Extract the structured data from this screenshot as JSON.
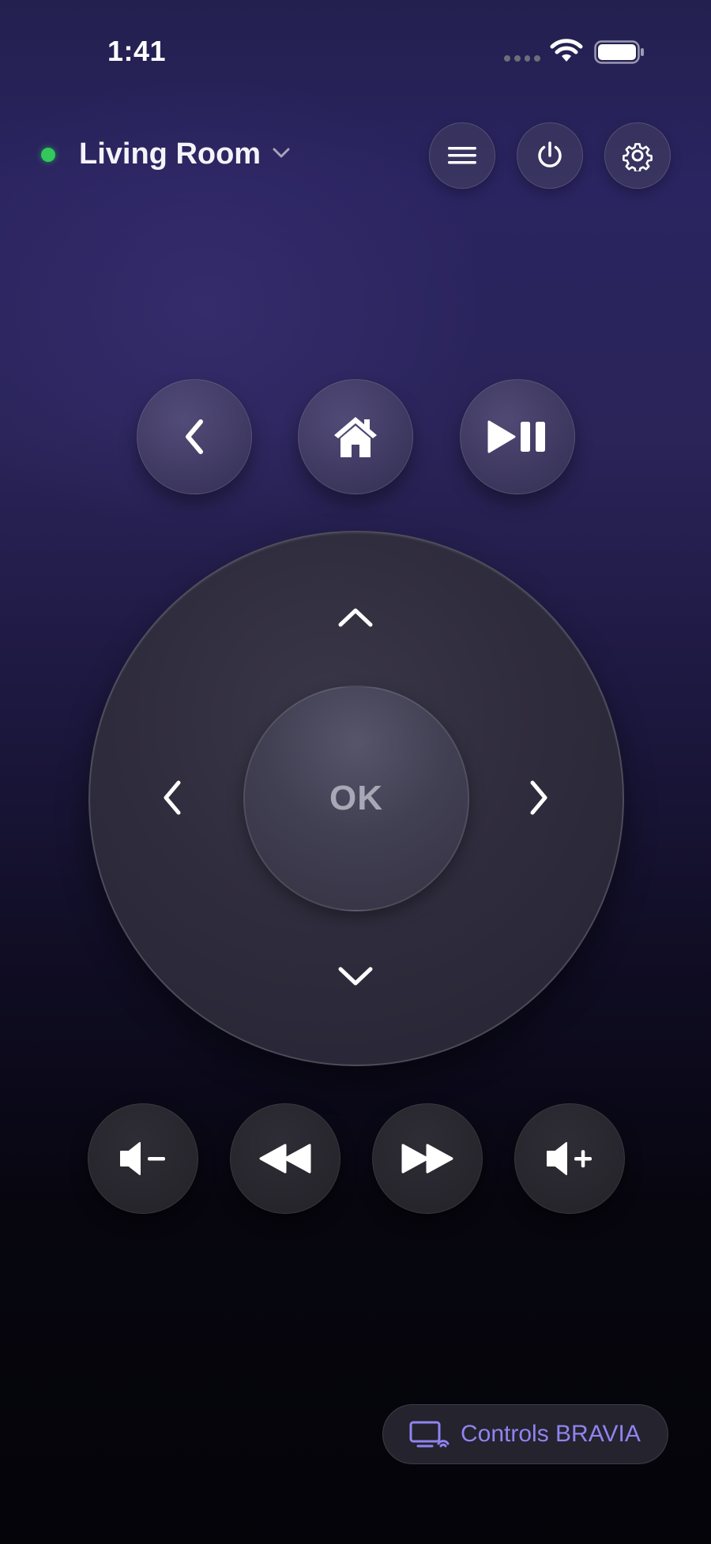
{
  "status_bar": {
    "time": "1:41"
  },
  "header": {
    "room_name": "Living Room",
    "status": "connected",
    "buttons": [
      {
        "name": "menu",
        "icon": "hamburger-icon"
      },
      {
        "name": "power",
        "icon": "power-icon"
      },
      {
        "name": "settings",
        "icon": "gear-icon"
      }
    ]
  },
  "top_row": [
    {
      "name": "back",
      "icon": "chevron-left-icon"
    },
    {
      "name": "home",
      "icon": "home-icon"
    },
    {
      "name": "play-pause",
      "icon": "play-pause-icon"
    }
  ],
  "dpad": {
    "ok_label": "OK"
  },
  "media_row": [
    {
      "name": "volume-down",
      "icon": "volume-minus-icon"
    },
    {
      "name": "rewind",
      "icon": "rewind-icon"
    },
    {
      "name": "fast-forward",
      "icon": "fast-forward-icon"
    },
    {
      "name": "volume-up",
      "icon": "volume-plus-icon"
    }
  ],
  "footer": {
    "controls_label": "Controls BRAVIA"
  },
  "colors": {
    "accent": "#8f84f0",
    "status_dot": "#32c85a"
  }
}
